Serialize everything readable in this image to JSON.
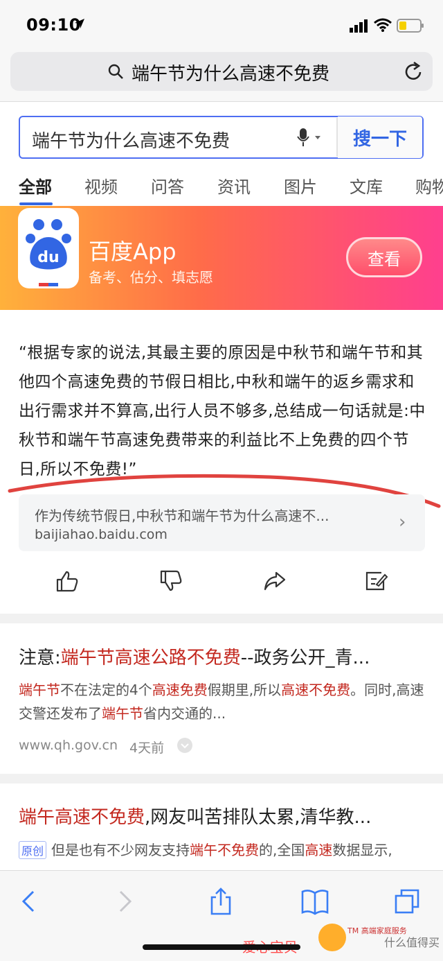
{
  "status": {
    "time": "09:10"
  },
  "address_bar": {
    "query": "端午节为什么高速不免费"
  },
  "search": {
    "query": "端午节为什么高速不免费",
    "button": "搜一下"
  },
  "tabs": [
    "全部",
    "视频",
    "问答",
    "资讯",
    "图片",
    "文库",
    "购物"
  ],
  "banner": {
    "app_name": "百度App",
    "subtitle": "备考、估分、填志愿",
    "button": "查看",
    "logo_text": "du"
  },
  "answer": {
    "text": "“根据专家的说法,其最主要的原因是中秋节和端午节和其他四个高速免费的节假日相比,中秋和端午的返乡需求和出行需求并不算高,出行人员不够多,总结成一句话就是:中秋节和端午节高速免费带来的利益比不上免费的四个节日,所以不免费!”"
  },
  "source": {
    "title": "作为传统节假日,中秋节和端午节为什么高速不...",
    "url": "baijiahao.baidu.com"
  },
  "result1": {
    "title_prefix": "注意:",
    "title_hl": "端午节高速公路不免费",
    "title_suffix": "--政务公开_青...",
    "snippet": [
      {
        "t": "端午节",
        "h": true
      },
      {
        "t": "不在法定的4个",
        "h": false
      },
      {
        "t": "高速免费",
        "h": true
      },
      {
        "t": "假期里,所以",
        "h": false
      },
      {
        "t": "高速不免费",
        "h": true
      },
      {
        "t": "。同时,高速交警还发布了",
        "h": false
      },
      {
        "t": "端午节",
        "h": true
      },
      {
        "t": "省内交通的...",
        "h": false
      }
    ],
    "url": "www.qh.gov.cn",
    "date": "4天前"
  },
  "result2": {
    "title_hl": "端午高速不免费",
    "title_suffix": ",网友叫苦排队太累,清华教...",
    "badge": "原创",
    "snippet": [
      {
        "t": "但是也有不少网友支持",
        "h": false
      },
      {
        "t": "端午不免费",
        "h": true
      },
      {
        "t": "的,全国",
        "h": false
      },
      {
        "t": "高速",
        "h": true
      },
      {
        "t": "数据显示,",
        "h": false
      }
    ]
  },
  "watermark": {
    "text1": "爱心宝贝",
    "text2": "TM 高端家庭服务",
    "text3": "什么值得买"
  },
  "colors": {
    "accent": "#3266e3",
    "highlight": "#c3281f",
    "banner_start": "#ffb13b",
    "banner_end": "#ff3f8e"
  }
}
